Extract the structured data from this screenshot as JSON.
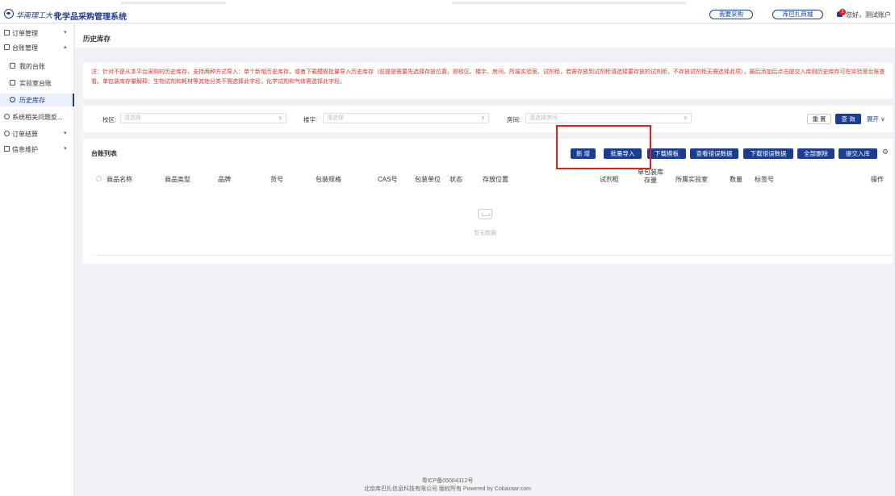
{
  "header": {
    "school_name": "华南理工大学",
    "system_title": "化学品采购管理系统",
    "buttons": [
      "我要采购",
      "库巴扎商城"
    ],
    "notification_count": "2",
    "greeting": "您好，测试账户"
  },
  "sidebar": {
    "items": [
      {
        "label": "订单管理",
        "icon": "order-icon",
        "chevron": "▾"
      },
      {
        "label": "台账管理",
        "icon": "ledger-icon",
        "chevron": "▴"
      },
      {
        "label": "我的台账",
        "icon": "my-ledger-icon"
      },
      {
        "label": "实验室台账",
        "icon": "lab-ledger-icon"
      },
      {
        "label": "历史库存",
        "icon": "history-icon"
      },
      {
        "label": "系统相关问题反...",
        "icon": "feedback-icon"
      },
      {
        "label": "订单结算",
        "icon": "settlement-icon",
        "chevron": "▾"
      },
      {
        "label": "信息维护",
        "icon": "info-icon",
        "chevron": "▾"
      }
    ]
  },
  "page": {
    "title": "历史库存",
    "notice": "注：针对不是从本平台采购的历史库存，支持两种方式导入：单个新增历史库存，或者下载模板批量导入历史库存（前提是需要先选择存放位置，即校区、楼宇、房间、所属实验室、试剂柜，若需存放到试剂柜请选择要存放的试剂柜，不存放试剂柜无需选择此项），最后添加后点击提交入库则历史库存可在实验室台账查看。单包装库存量解释：生物试剂和耗材等其他分类不需选择此字段，化学试剂和气体需选择此字段。"
  },
  "filters": {
    "campus_label": "校区:",
    "campus_placeholder": "请选择",
    "building_label": "楼宇:",
    "building_placeholder": "请选择",
    "room_label": "房间:",
    "room_placeholder": "请选择房间",
    "reset": "重 置",
    "query": "查 询",
    "expand": "展开 ∨"
  },
  "table": {
    "title": "台账列表",
    "actions": [
      "新 增",
      "批量导入",
      "下载模板",
      "查看错误数据",
      "下载错误数据",
      "全部删除",
      "提交入库"
    ],
    "columns": [
      "商品名称",
      "商品类型",
      "品牌",
      "货号",
      "包装规格",
      "CAS号",
      "包装单位",
      "状态",
      "存放位置",
      "试剂柜",
      "单包装库存量",
      "所属实验室",
      "数量",
      "标签号",
      "操作"
    ],
    "empty_text": "暂无数据"
  },
  "footer": {
    "icp": "粤ICP备05084312号",
    "copyright": "北京库巴扎信息科技有限公司 版权所有 Powered by Cobazaar.com"
  },
  "colors": {
    "primary": "#1a3d8f",
    "notice": "#e8332a",
    "highlight": "#e02020"
  }
}
